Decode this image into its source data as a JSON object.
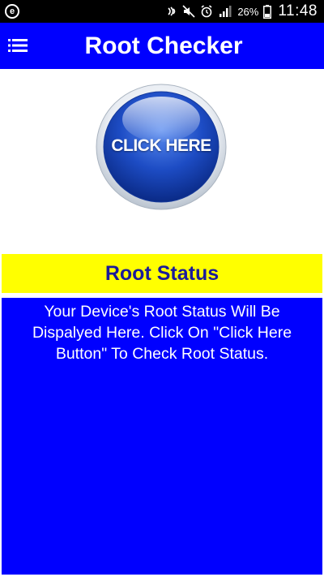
{
  "status_bar": {
    "notification_icon": "e",
    "battery_percent": "26%",
    "time": "11:48",
    "icons": [
      "nfc-icon",
      "mute-icon",
      "alarm-icon",
      "signal-icon",
      "battery-icon"
    ]
  },
  "app_bar": {
    "title": "Root Checker",
    "menu_icon": "menu-icon"
  },
  "check_button": {
    "label": "CLICK HERE"
  },
  "root_status": {
    "header": "Root Status",
    "message": "Your Device's Root Status Will Be Dispalyed Here. Click On \"Click Here Button\" To Check Root Status."
  },
  "colors": {
    "primary": "#0000ff",
    "header_bg": "#ffff00",
    "header_text": "#1a1a9a",
    "status_bar": "#000000"
  }
}
